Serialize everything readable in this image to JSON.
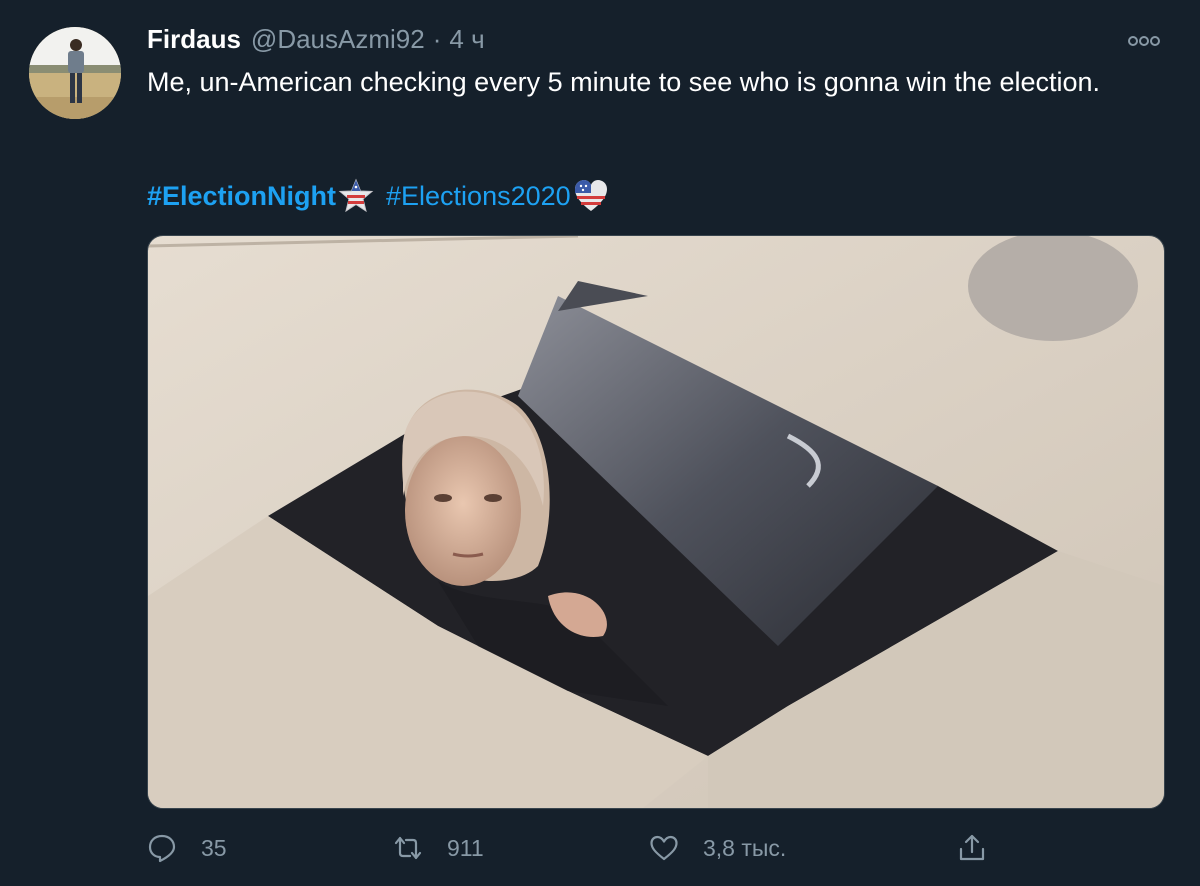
{
  "tweet": {
    "author_name": "Firdaus",
    "author_handle": "@DausAzmi92",
    "separator": "·",
    "time": "4 ч",
    "text": "Me, un-American checking every 5 minute to see who is gonna win the election.",
    "hashtags": [
      {
        "text": "#ElectionNight",
        "emoji": "star-flag-emoji"
      },
      {
        "text": "#Elections2020",
        "emoji": "heart-flag-emoji"
      }
    ],
    "media": {
      "icon": "photo-ceiling-tile-person"
    }
  },
  "actions": {
    "reply": {
      "icon": "reply-icon",
      "count": "35"
    },
    "retweet": {
      "icon": "retweet-icon",
      "count": "911"
    },
    "like": {
      "icon": "heart-icon",
      "count": "3,8 тыс."
    },
    "share": {
      "icon": "share-icon"
    }
  },
  "colors": {
    "background": "#15202b",
    "text": "#ffffff",
    "muted": "#8899a6",
    "link": "#1da1f2",
    "border": "#38444d"
  }
}
